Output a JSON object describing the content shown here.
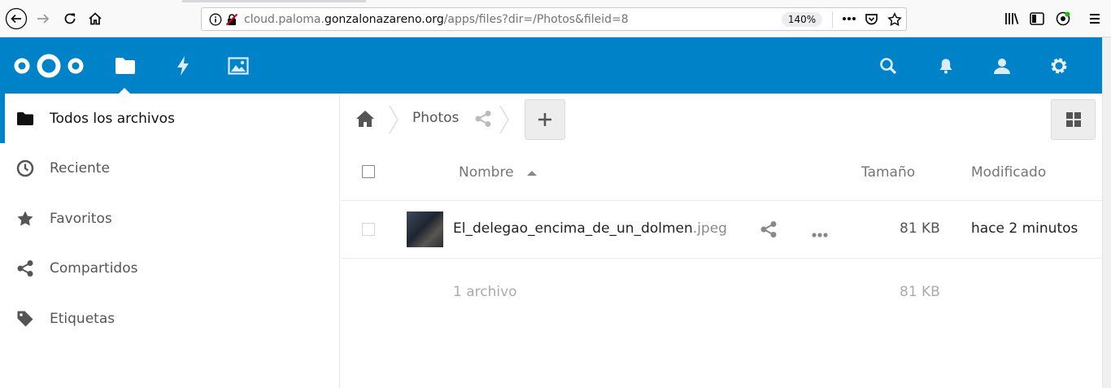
{
  "browser": {
    "url_prefix": "cloud.paloma.",
    "url_domain": "gonzalonazareno.org",
    "url_path": "/apps/files?dir=/Photos&fileid=8",
    "zoom": "140%"
  },
  "header": {
    "nav_icons": [
      "files-icon",
      "activity-icon",
      "gallery-icon"
    ],
    "right_icons": [
      "search-icon",
      "notifications-icon",
      "contacts-icon",
      "settings-icon"
    ]
  },
  "sidebar": {
    "items": [
      {
        "label": "Todos los archivos",
        "icon": "folder-icon",
        "active": true
      },
      {
        "label": "Reciente",
        "icon": "clock-icon"
      },
      {
        "label": "Favoritos",
        "icon": "star-icon"
      },
      {
        "label": "Compartidos",
        "icon": "share-icon"
      },
      {
        "label": "Etiquetas",
        "icon": "tag-icon"
      }
    ]
  },
  "breadcrumb": {
    "folder": "Photos"
  },
  "table": {
    "headers": {
      "name": "Nombre",
      "size": "Tamaño",
      "modified": "Modificado"
    },
    "files": [
      {
        "name": "El_delegao_encima_de_un_dolmen",
        "ext": ".jpeg",
        "size": "81 KB",
        "modified": "hace 2 minutos"
      }
    ],
    "summary": {
      "count": "1 archivo",
      "size": "81 KB"
    }
  },
  "colors": {
    "brand": "#0082c9"
  }
}
